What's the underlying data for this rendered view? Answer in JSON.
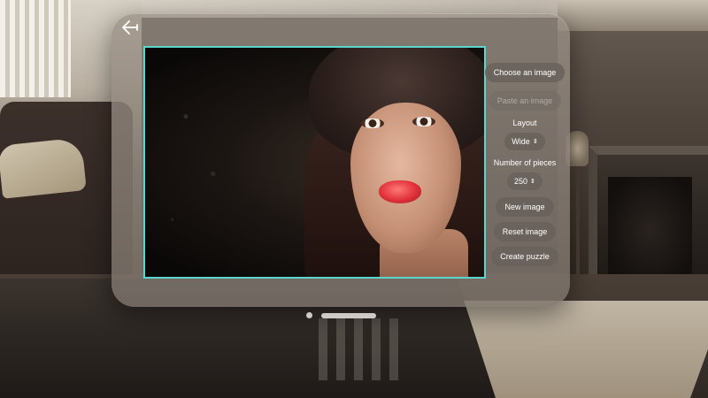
{
  "app": {
    "back_icon": "back-arrow-icon"
  },
  "preview": {
    "border_color": "#5ad6cd"
  },
  "controls": {
    "choose_image": "Choose an image",
    "paste_image": "Paste an image",
    "layout_label": "Layout",
    "layout_value": "Wide",
    "pieces_label": "Number of pieces",
    "pieces_value": "250",
    "new_image": "New image",
    "reset_image": "Reset image",
    "create_puzzle": "Create puzzle"
  },
  "system": {
    "window_controls": [
      "window-close-dot",
      "window-grab-bar"
    ]
  }
}
